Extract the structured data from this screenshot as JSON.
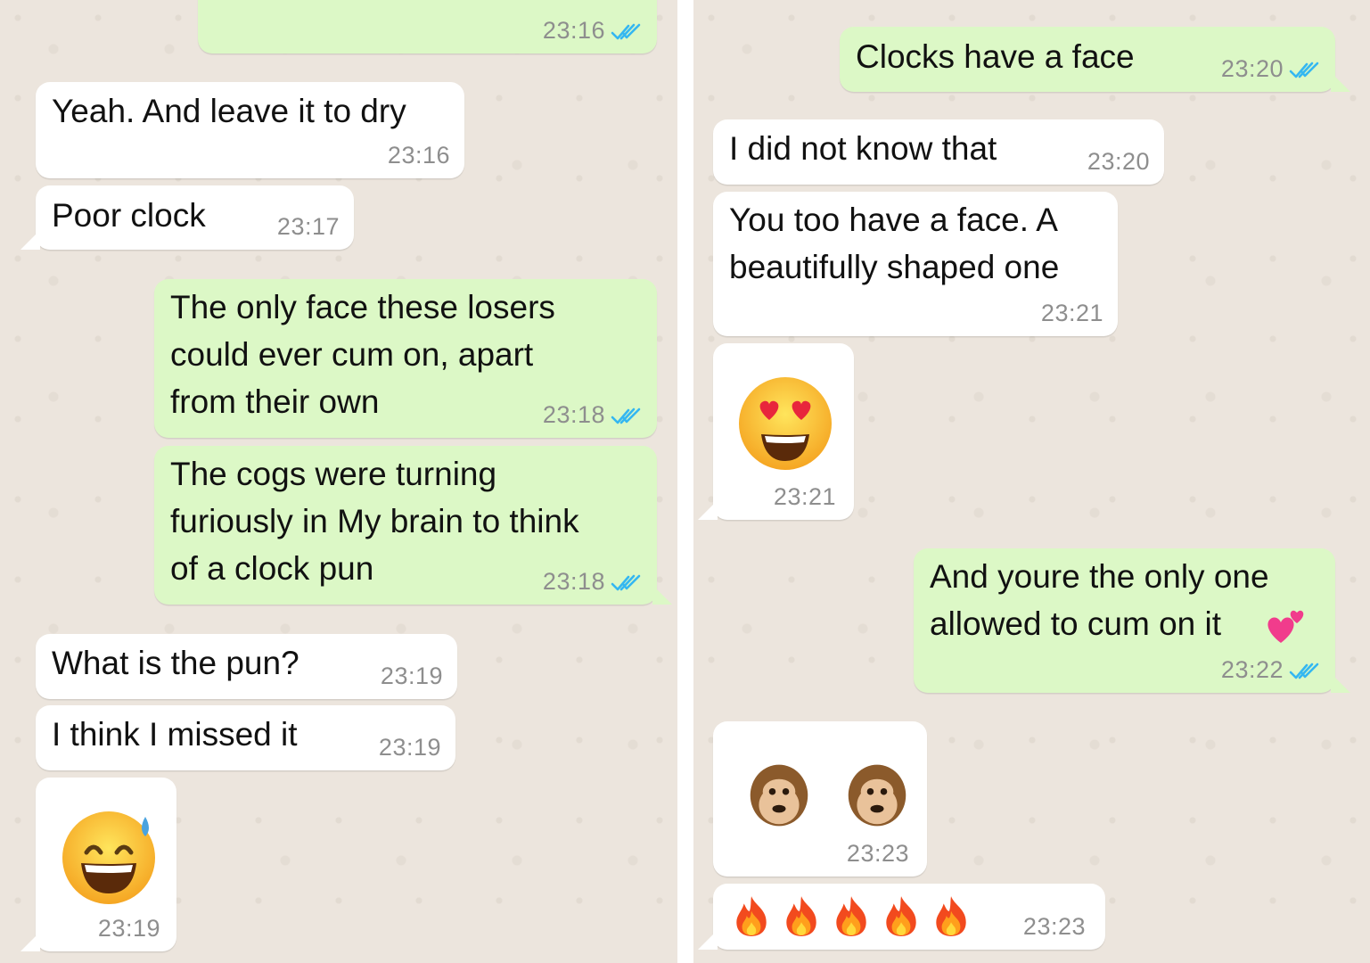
{
  "colors": {
    "incoming_bubble": "#ffffff",
    "outgoing_bubble": "#dcf8c6",
    "chat_background": "#ece5dd",
    "read_ticks": "#34b7f1",
    "timestamp": "#8e8e8e"
  },
  "left_panel": {
    "messages": [
      {
        "direction": "outgoing",
        "text": "",
        "time": "23:16",
        "status": "read"
      },
      {
        "direction": "incoming",
        "text": "Yeah. And leave it to dry",
        "time": "23:16"
      },
      {
        "direction": "incoming",
        "text": "Poor clock",
        "time": "23:17"
      },
      {
        "direction": "outgoing",
        "text": "The only face these losers\ncould ever cum on, apart\nfrom their own",
        "time": "23:18",
        "status": "read"
      },
      {
        "direction": "outgoing",
        "text": "The cogs were turning\nfuriously in My brain to think\nof a clock pun",
        "time": "23:18",
        "status": "read"
      },
      {
        "direction": "incoming",
        "text": "What is the pun?",
        "time": "23:19"
      },
      {
        "direction": "incoming",
        "text": "I think I missed it",
        "time": "23:19"
      },
      {
        "direction": "incoming",
        "emoji": "grinning-face-with-sweat",
        "time": "23:19"
      }
    ]
  },
  "right_panel": {
    "messages": [
      {
        "direction": "outgoing",
        "text": "Clocks have a face",
        "time": "23:20",
        "status": "read"
      },
      {
        "direction": "incoming",
        "text": "I did not know that",
        "time": "23:20"
      },
      {
        "direction": "incoming",
        "text": "You too have a face. A\nbeautifully shaped one",
        "time": "23:21"
      },
      {
        "direction": "incoming",
        "emoji": "smiling-face-with-heart-eyes",
        "time": "23:21"
      },
      {
        "direction": "outgoing",
        "text": "And youre the only one\nallowed to cum on it",
        "emoji": "two-hearts",
        "time": "23:22",
        "status": "read"
      },
      {
        "direction": "incoming",
        "emoji": "hear-no-evil-monkey see-no-evil-monkey",
        "time": "23:23"
      },
      {
        "direction": "incoming",
        "emoji": "fire x5",
        "time": "23:23"
      }
    ]
  }
}
